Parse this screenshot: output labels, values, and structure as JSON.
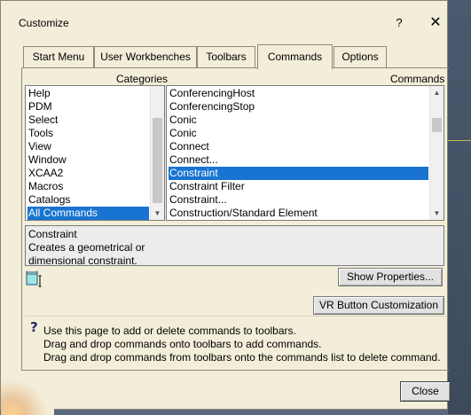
{
  "window": {
    "title": "Customize"
  },
  "titlebar": {
    "help_label": "?",
    "close_label": "✕"
  },
  "tabs": [
    {
      "label": "Start Menu",
      "active": false
    },
    {
      "label": "User Workbenches",
      "active": false
    },
    {
      "label": "Toolbars",
      "active": false
    },
    {
      "label": "Commands",
      "active": true
    },
    {
      "label": "Options",
      "active": false
    }
  ],
  "categories": {
    "label": "Categories",
    "items": [
      "Help",
      "PDM",
      "Select",
      "Tools",
      "View",
      "Window",
      "XCAA2",
      "Macros",
      "Catalogs",
      "All Commands"
    ],
    "selected": "All Commands"
  },
  "commands": {
    "label": "Commands",
    "items": [
      "ConferencingHost",
      "ConferencingStop",
      "Conic",
      "Conic",
      "Connect",
      "Connect...",
      "Constraint",
      "Constraint Filter",
      "Constraint...",
      "Construction/Standard Element"
    ],
    "selected": "Constraint"
  },
  "description": {
    "name": "Constraint",
    "text_line1": "Creates a geometrical or",
    "text_line2": "dimensional constraint."
  },
  "icons": {
    "command_icon": "constraint-icon",
    "info_icon": "question-icon"
  },
  "buttons": {
    "show_properties": "Show Properties...",
    "vr_button": "VR Button Customization",
    "close": "Close"
  },
  "info": {
    "line1": "Use this page to add or delete commands to toolbars.",
    "line2": "Drag and drop commands onto toolbars to add commands.",
    "line3": "Drag and drop commands from toolbars onto the commands list to delete command."
  },
  "colors": {
    "dialog_bg": "#f3eed9",
    "selection": "#1874d0"
  }
}
